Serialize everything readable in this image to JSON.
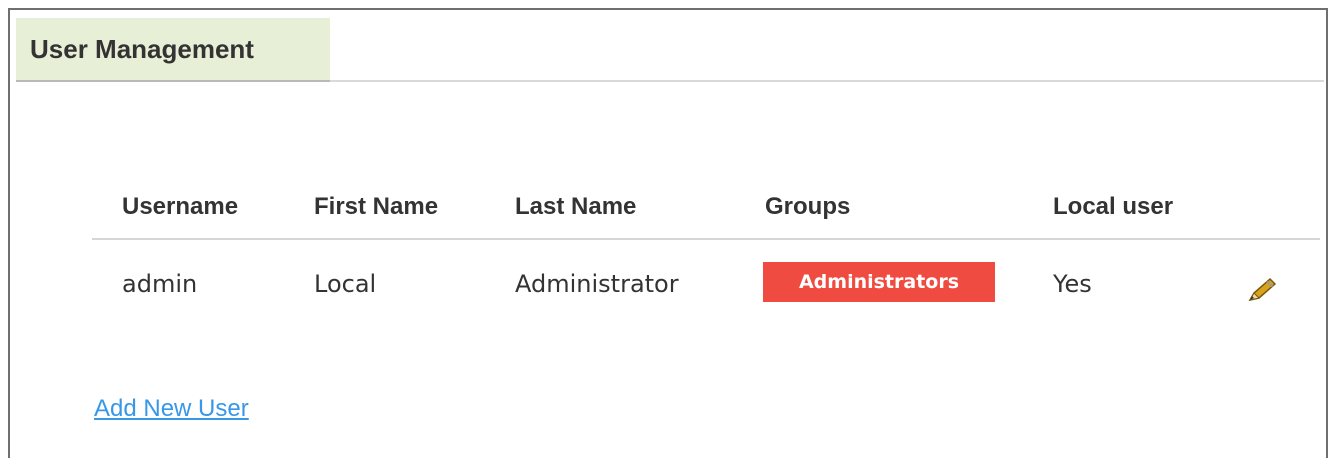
{
  "panel": {
    "title": "User Management"
  },
  "table": {
    "headers": [
      "Username",
      "First Name",
      "Last Name",
      "Groups",
      "Local user"
    ],
    "rows": [
      {
        "username": "admin",
        "first_name": "Local",
        "last_name": "Administrator",
        "group": "Administrators",
        "local_user": "Yes",
        "edit_icon": "pencil-icon"
      }
    ]
  },
  "actions": {
    "add_user_label": "Add New User"
  },
  "colors": {
    "tab_background": "#e7f0d6",
    "badge_background": "#f04b41",
    "link": "#3797e8",
    "text": "#333333"
  }
}
